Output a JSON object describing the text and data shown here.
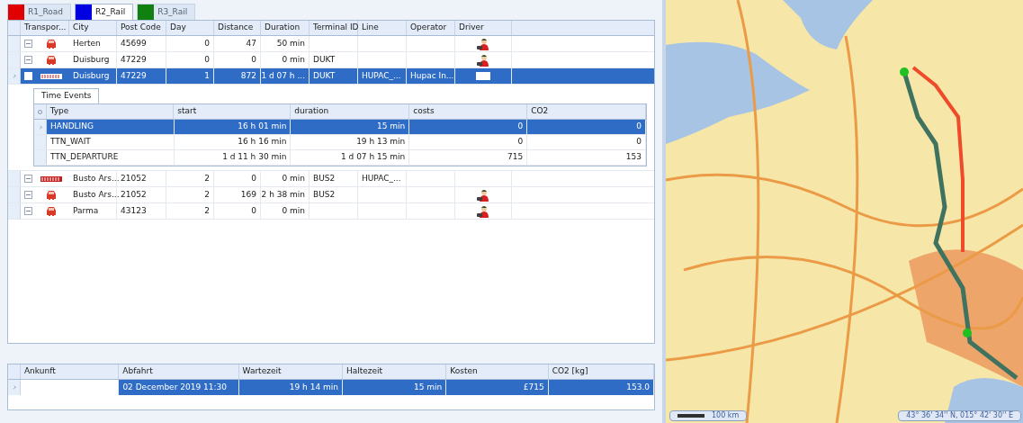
{
  "route_tabs": [
    {
      "label": "R1_Road",
      "color": "#e00000",
      "selected": false
    },
    {
      "label": "R2_Rail",
      "color": "#0000e0",
      "selected": true
    },
    {
      "label": "R3_Rail",
      "color": "#108010",
      "selected": false
    }
  ],
  "stops": {
    "columns": [
      "Transpor...",
      "City",
      "Post Code",
      "Day",
      "Distance",
      "Duration",
      "Terminal ID",
      "Line",
      "Operator",
      "Driver"
    ],
    "rows": [
      {
        "kind": "road",
        "selected": false,
        "expanded": false,
        "driver": true,
        "cells": [
          "",
          "Herten",
          "45699",
          "0",
          "47",
          "50 min",
          "",
          "",
          ""
        ]
      },
      {
        "kind": "road",
        "selected": false,
        "expanded": false,
        "driver": true,
        "cells": [
          "",
          "Duisburg",
          "47229",
          "0",
          "0",
          "0 min",
          "DUKT",
          "",
          ""
        ]
      },
      {
        "kind": "rail",
        "selected": true,
        "expanded": true,
        "driver": false,
        "cells": [
          "",
          "Duisburg",
          "47229",
          "1",
          "872",
          "1 d 07 h ...",
          "DUKT",
          "HUPAC_...",
          "Hupac In..."
        ]
      },
      {
        "kind": "rail",
        "selected": false,
        "expanded": false,
        "driver": false,
        "cells": [
          "",
          "Busto Ars...",
          "21052",
          "2",
          "0",
          "0 min",
          "BUS2",
          "HUPAC_...",
          ""
        ]
      },
      {
        "kind": "road",
        "selected": false,
        "expanded": false,
        "driver": true,
        "cells": [
          "",
          "Busto Ars...",
          "21052",
          "2",
          "169",
          "2 h 38 min",
          "BUS2",
          "",
          ""
        ]
      },
      {
        "kind": "road",
        "selected": false,
        "expanded": false,
        "driver": true,
        "cells": [
          "",
          "Parma",
          "43123",
          "2",
          "0",
          "0 min",
          "",
          "",
          ""
        ]
      }
    ]
  },
  "time_events": {
    "tab": "Time Events",
    "columns": [
      "Type",
      "start",
      "duration",
      "costs",
      "CO2"
    ],
    "rows": [
      {
        "selected": true,
        "cells": [
          "HANDLING",
          "16 h 01 min",
          "15 min",
          "0",
          "0"
        ]
      },
      {
        "selected": false,
        "cells": [
          "TTN_WAIT",
          "16 h 16 min",
          "19 h 13 min",
          "0",
          "0"
        ]
      },
      {
        "selected": false,
        "cells": [
          "TTN_DEPARTURE",
          "1 d 11 h 30 min",
          "1 d 07 h 15 min",
          "715",
          "153"
        ]
      }
    ]
  },
  "summary": {
    "columns": [
      "Ankunft",
      "Abfahrt",
      "Wartezeit",
      "Haltezeit",
      "Kosten",
      "CO2 [kg]"
    ],
    "rows": [
      {
        "selected": true,
        "cells": [
          "",
          "02 December 2019 11:30",
          "19 h 14 min",
          "15 min",
          "£715",
          "153.0"
        ]
      }
    ]
  },
  "map": {
    "kind": "picture",
    "scale": "100 km",
    "coordinates": "43° 36' 34'' N, 015° 42' 30'' E"
  }
}
